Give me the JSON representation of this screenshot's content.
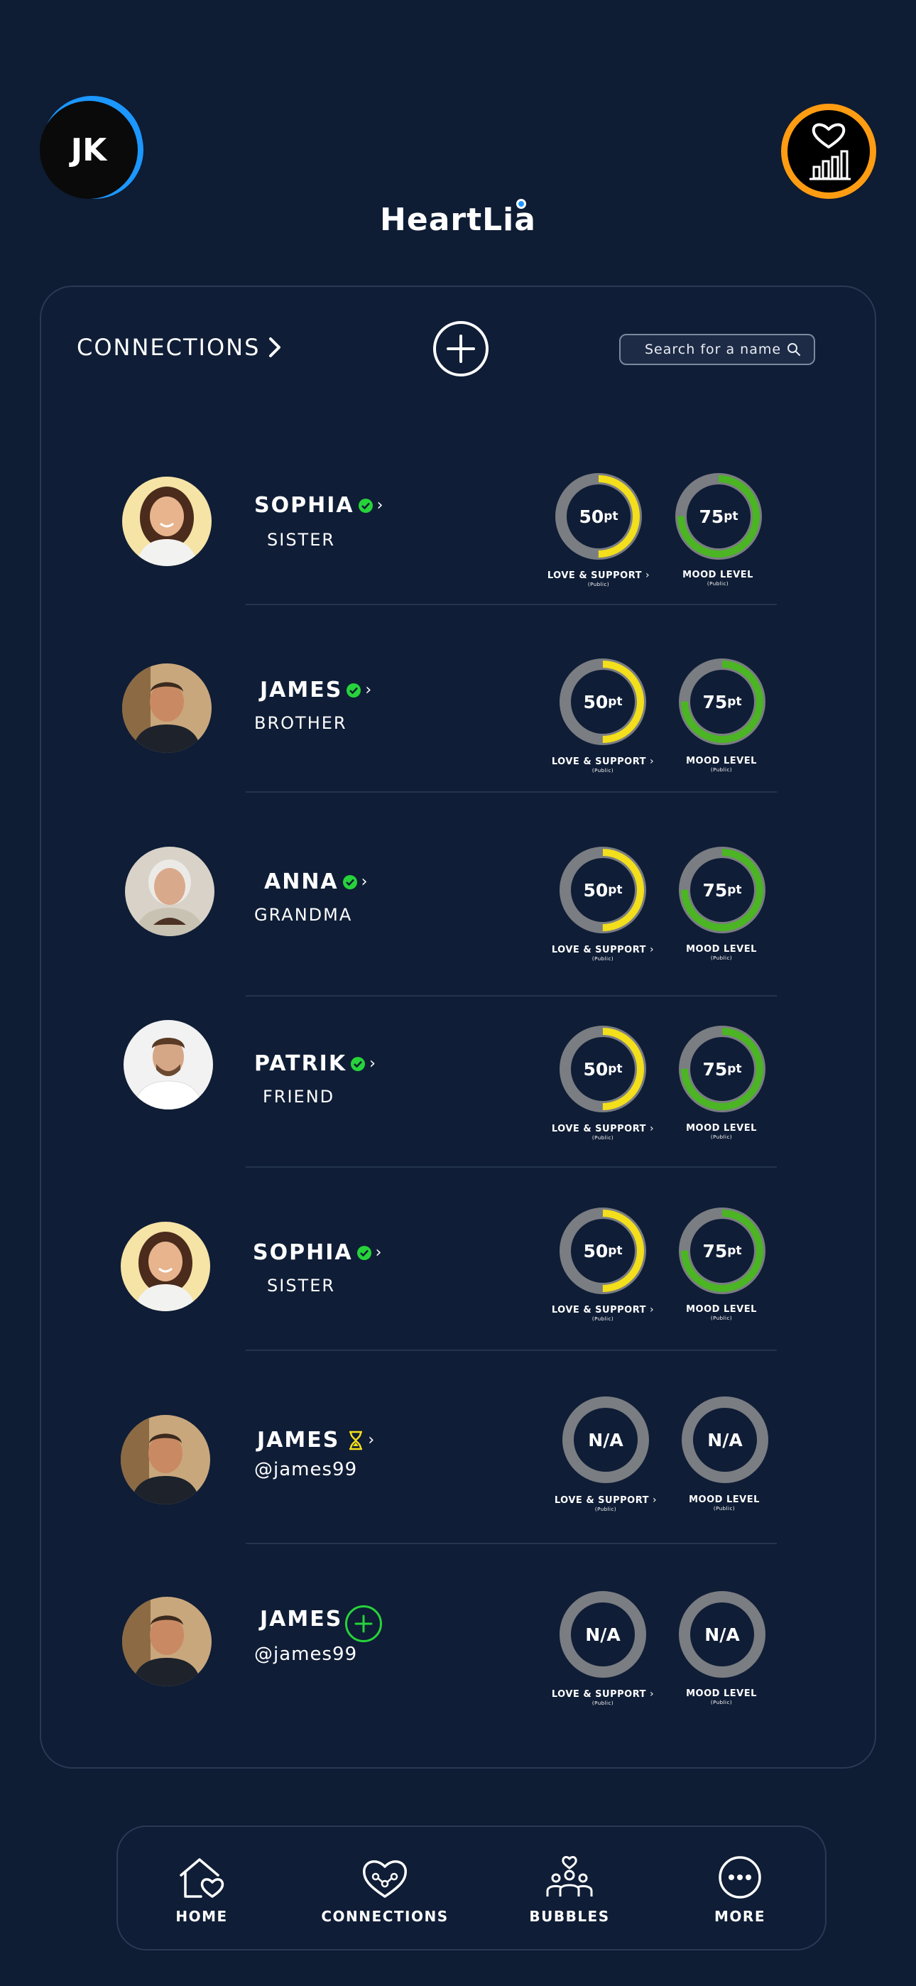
{
  "header": {
    "user_initials": "JK",
    "app_name": "HeartLia"
  },
  "connections_section": {
    "title": "CONNECTIONS",
    "search_placeholder": "Search for a name"
  },
  "gauge_labels": {
    "love": "LOVE & SUPPORT",
    "mood": "MOOD LEVEL",
    "visibility": "(Public)"
  },
  "colors": {
    "love_accent": "#f3df1b",
    "mood_accent": "#4bb524",
    "verified": "#27d33a",
    "pending": "#f3df1b",
    "user_ring": "#1c97ff",
    "stats_ring": "#ff9c12"
  },
  "connections": [
    {
      "name": "SOPHIA",
      "subtitle": "SISTER",
      "status": "verified",
      "love": "50",
      "love_unit": "pt",
      "love_pct": 0.5,
      "mood": "75",
      "mood_unit": "pt",
      "mood_pct": 0.75
    },
    {
      "name": "JAMES",
      "subtitle": "BROTHER",
      "status": "verified",
      "love": "50",
      "love_unit": "pt",
      "love_pct": 0.5,
      "mood": "75",
      "mood_unit": "pt",
      "mood_pct": 0.75
    },
    {
      "name": "ANNA",
      "subtitle": "GRANDMA",
      "status": "verified",
      "love": "50",
      "love_unit": "pt",
      "love_pct": 0.5,
      "mood": "75",
      "mood_unit": "pt",
      "mood_pct": 0.75
    },
    {
      "name": "PATRIK",
      "subtitle": "FRIEND",
      "status": "verified",
      "love": "50",
      "love_unit": "pt",
      "love_pct": 0.5,
      "mood": "75",
      "mood_unit": "pt",
      "mood_pct": 0.75
    },
    {
      "name": "SOPHIA",
      "subtitle": "SISTER",
      "status": "verified",
      "love": "50",
      "love_unit": "pt",
      "love_pct": 0.5,
      "mood": "75",
      "mood_unit": "pt",
      "mood_pct": 0.75
    },
    {
      "name": "JAMES",
      "subtitle": "@james99",
      "status": "pending",
      "love": "N/A",
      "love_unit": "",
      "love_pct": 0,
      "mood": "N/A",
      "mood_unit": "",
      "mood_pct": 0
    },
    {
      "name": "JAMES",
      "subtitle": "@james99",
      "status": "add",
      "love": "N/A",
      "love_unit": "",
      "love_pct": 0,
      "mood": "N/A",
      "mood_unit": "",
      "mood_pct": 0
    }
  ],
  "nav": {
    "home": "HOME",
    "connections": "CONNECTIONS",
    "bubbles": "BUBBLES",
    "more": "MORE"
  }
}
